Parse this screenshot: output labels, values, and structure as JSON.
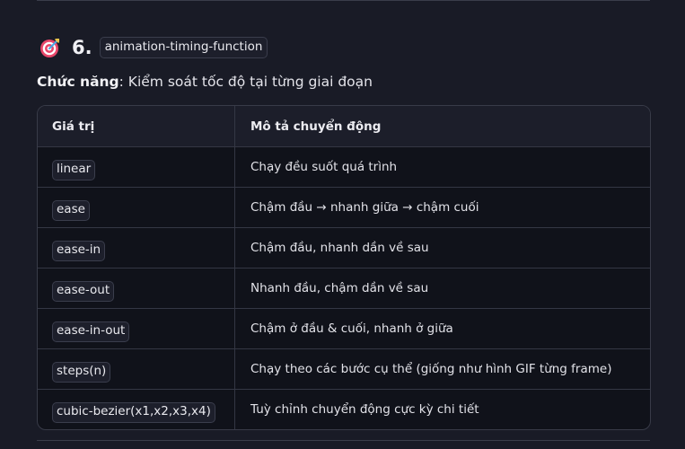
{
  "section": {
    "emoji_icon": "direct-hit-target-icon",
    "number": "6.",
    "property": "animation-timing-function",
    "desc_label": "Chức năng",
    "desc_text": ": Kiểm soát tốc độ tại từng giai đoạn"
  },
  "table": {
    "headers": [
      "Giá trị",
      "Mô tả chuyển động"
    ],
    "rows": [
      {
        "value": "linear",
        "description": "Chạy đều suốt quá trình"
      },
      {
        "value": "ease",
        "description": "Chậm đầu → nhanh giữa → chậm cuối"
      },
      {
        "value": "ease-in",
        "description": "Chậm đầu, nhanh dần về sau"
      },
      {
        "value": "ease-out",
        "description": "Nhanh đầu, chậm dần về sau"
      },
      {
        "value": "ease-in-out",
        "description": "Chậm ở đầu & cuối, nhanh ở giữa"
      },
      {
        "value": "steps(n)",
        "description": "Chạy theo các bước cụ thể (giống như hình GIF từng frame)"
      },
      {
        "value": "cubic-bezier(x1,x2,x3,x4)",
        "description": "Tuỳ chỉnh chuyển động cực kỳ chi tiết"
      }
    ]
  },
  "colors": {
    "background": "#191b26",
    "table_body": "#10121a",
    "table_header": "#1c1e2a",
    "border": "#383b48"
  }
}
